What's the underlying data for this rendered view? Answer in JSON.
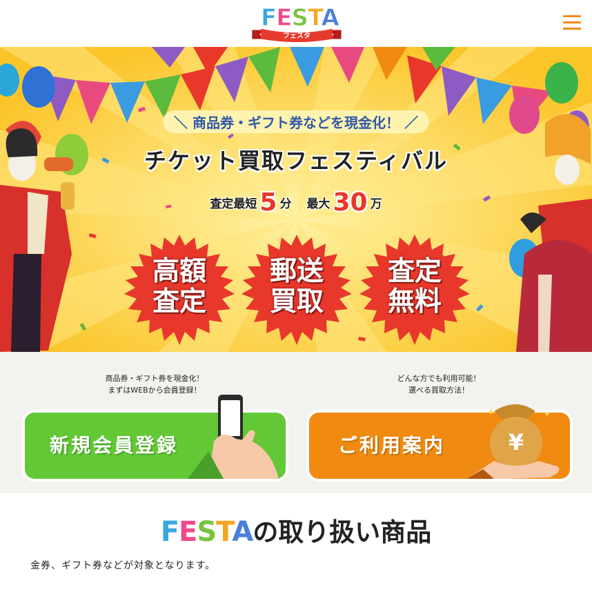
{
  "header": {
    "logo_letters": [
      "F",
      "E",
      "S",
      "T",
      "A"
    ],
    "logo_colors": [
      "#3aa8e0",
      "#ef4b8b",
      "#7cc241",
      "#f6a623",
      "#4b7fd8"
    ],
    "logo_sub": "フェスタ",
    "menu_icon": "hamburger-menu-icon",
    "accent": "#f08a1a"
  },
  "hero": {
    "catch": "＼ 商品券・ギフト券などを現金化！ ／",
    "title": "チケット買取フェスティバル",
    "stat1_label": "査定最短",
    "stat1_value": "5",
    "stat1_unit": "分",
    "stat2_label": "最大",
    "stat2_value": "30",
    "stat2_unit": "万",
    "badges": [
      {
        "line1": "高額",
        "line2": "査定"
      },
      {
        "line1": "郵送",
        "line2": "買取"
      },
      {
        "line1": "査定",
        "line2": "無料"
      }
    ],
    "badge_color": "#e8382b"
  },
  "cta": {
    "register_note_1": "商品券・ギフト券を現金化！",
    "register_note_2": "まずはWEBから会員登録！",
    "register_label": "新規会員登録",
    "register_icon": "smartphone-hand-icon",
    "guide_note_1": "どんな方でも利用可能！",
    "guide_note_2": "選べる買取方法！",
    "guide_label": "ご利用案内",
    "guide_icon": "money-bag-yen-icon"
  },
  "products": {
    "title_logo": "FESTA",
    "title_rest": "の取り扱い商品",
    "description": "金券、ギフト券などが対象となります。"
  }
}
